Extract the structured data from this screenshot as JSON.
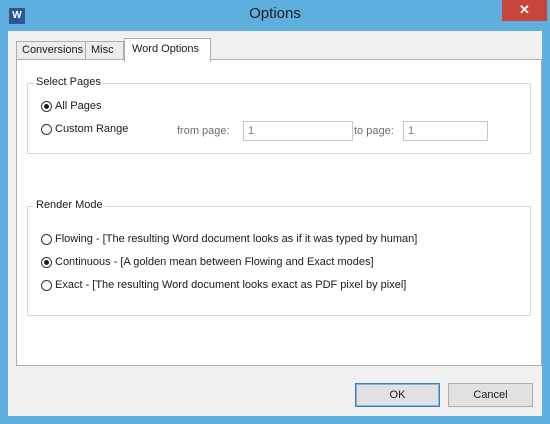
{
  "window": {
    "title": "Options",
    "app_icon_letter": "W",
    "close_glyph": "✕"
  },
  "tabs": [
    {
      "label": "Conversions",
      "active": false
    },
    {
      "label": "Misc",
      "active": false
    },
    {
      "label": "Word Options",
      "active": true
    }
  ],
  "select_pages": {
    "group_label": "Select Pages",
    "options": [
      {
        "label": "All Pages",
        "checked": true
      },
      {
        "label": "Custom Range",
        "checked": false
      }
    ],
    "from_page_label": "from page:",
    "from_page_value": "1",
    "to_page_label": "to page:",
    "to_page_value": "1"
  },
  "render_mode": {
    "group_label": "Render Mode",
    "options": [
      {
        "label": "Flowing - [The resulting Word document looks as if it was typed by human]",
        "checked": false
      },
      {
        "label": "Continuous - [A golden mean between Flowing and Exact modes]",
        "checked": true
      },
      {
        "label": "Exact - [The resulting Word document looks exact as PDF pixel by pixel]",
        "checked": false
      }
    ]
  },
  "buttons": {
    "ok": "OK",
    "cancel": "Cancel"
  },
  "colors": {
    "frame": "#5eaede",
    "close": "#c7453b",
    "client": "#f0f0f0"
  }
}
